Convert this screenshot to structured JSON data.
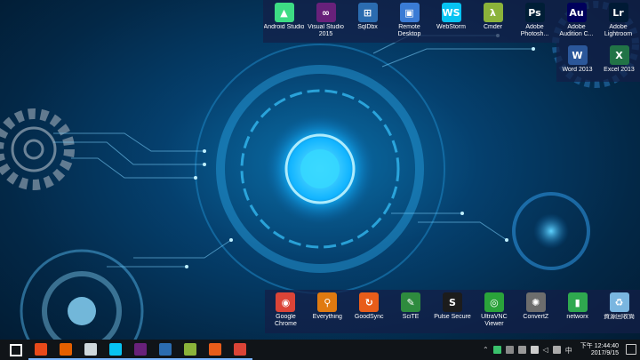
{
  "top_dock": [
    {
      "label": "Android Studio",
      "icon": "android-studio-icon",
      "color": "#3ddc84",
      "glyph": "▲"
    },
    {
      "label": "Visual Studio 2015",
      "icon": "visual-studio-icon",
      "color": "#68217a",
      "glyph": "∞"
    },
    {
      "label": "SqlDbx",
      "icon": "sqldbx-icon",
      "color": "#2b6cb0",
      "glyph": "⊞"
    },
    {
      "label": "Remote Desktop",
      "icon": "remote-desktop-icon",
      "color": "#3a7bd5",
      "glyph": "▣"
    },
    {
      "label": "WebStorm",
      "icon": "webstorm-icon",
      "color": "#07c3f2",
      "glyph": "WS"
    },
    {
      "label": "Cmder",
      "icon": "cmder-icon",
      "color": "#8bb33a",
      "glyph": "λ"
    },
    {
      "label": "Adobe Photosh...",
      "icon": "photoshop-icon",
      "color": "#001e36",
      "glyph": "Ps"
    },
    {
      "label": "Adobe Audition C...",
      "icon": "audition-icon",
      "color": "#00005b",
      "glyph": "Au"
    },
    {
      "label": "Adobe Lightroom",
      "icon": "lightroom-icon",
      "color": "#001a35",
      "glyph": "Lr"
    }
  ],
  "side_dock": [
    {
      "label": "Word 2013",
      "icon": "word-icon",
      "color": "#2b579a",
      "glyph": "W"
    },
    {
      "label": "Excel 2013",
      "icon": "excel-icon",
      "color": "#217346",
      "glyph": "X"
    }
  ],
  "bottom_dock": [
    {
      "label": "Google Chrome",
      "icon": "chrome-icon",
      "color": "#db4437",
      "glyph": "◉"
    },
    {
      "label": "Everything",
      "icon": "everything-icon",
      "color": "#e07a10",
      "glyph": "⚲"
    },
    {
      "label": "GoodSync",
      "icon": "goodsync-icon",
      "color": "#e85d1a",
      "glyph": "↻"
    },
    {
      "label": "SciTE",
      "icon": "scite-icon",
      "color": "#2e8b3e",
      "glyph": "✎"
    },
    {
      "label": "Pulse Secure",
      "icon": "pulse-secure-icon",
      "color": "#1c1c1c",
      "glyph": "S"
    },
    {
      "label": "UltraVNC Viewer",
      "icon": "ultravnc-icon",
      "color": "#2aa33a",
      "glyph": "◎"
    },
    {
      "label": "ConvertZ",
      "icon": "convertz-icon",
      "color": "#6d6d6d",
      "glyph": "✺"
    },
    {
      "label": "networx",
      "icon": "networx-icon",
      "color": "#2fa84f",
      "glyph": "▮"
    },
    {
      "label": "資源回收筒",
      "icon": "recycle-bin-icon",
      "color": "#7ab6e0",
      "glyph": "♻"
    }
  ],
  "taskbar": {
    "apps": [
      {
        "name": "start-menu",
        "icon": "windows-logo-icon",
        "color": "#ffffff"
      },
      {
        "name": "taskbar-app-1",
        "icon": "orange-app-icon",
        "color": "#e84a1a"
      },
      {
        "name": "taskbar-firefox",
        "icon": "firefox-icon",
        "color": "#e66000"
      },
      {
        "name": "taskbar-file",
        "icon": "document-icon",
        "color": "#cfd8dc"
      },
      {
        "name": "taskbar-webstorm",
        "icon": "webstorm-icon",
        "color": "#07c3f2"
      },
      {
        "name": "taskbar-visual-studio",
        "icon": "visual-studio-icon",
        "color": "#68217a"
      },
      {
        "name": "taskbar-sqldbx",
        "icon": "sqldbx-icon",
        "color": "#2b6cb0"
      },
      {
        "name": "taskbar-cmder",
        "icon": "cmder-icon",
        "color": "#8bb33a"
      },
      {
        "name": "taskbar-goodsync",
        "icon": "goodsync-icon",
        "color": "#e85d1a"
      },
      {
        "name": "taskbar-chrome",
        "icon": "chrome-icon",
        "color": "#db4437"
      }
    ],
    "clock": {
      "time": "下午 12:44:40",
      "date": "2017/9/15"
    }
  }
}
